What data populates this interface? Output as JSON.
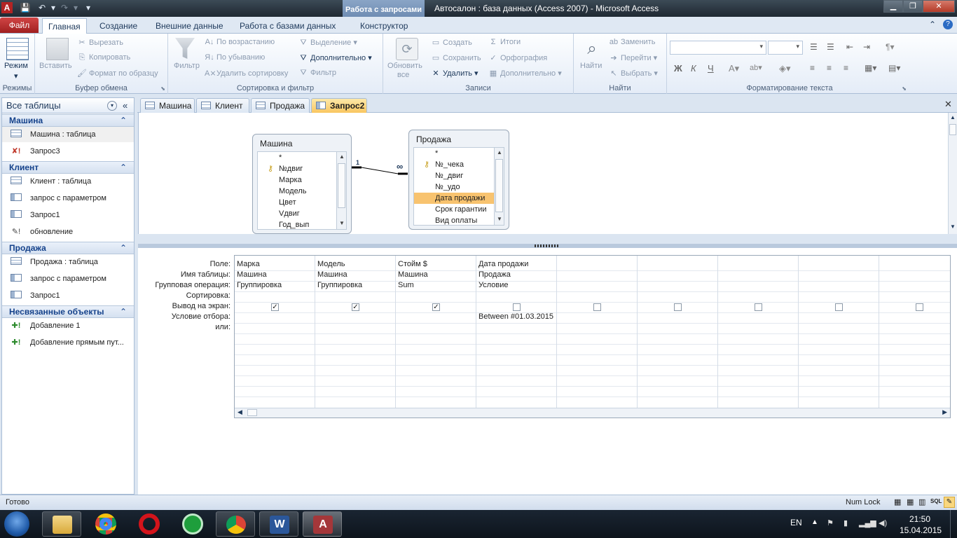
{
  "window": {
    "title": "Автосалон : база данных (Access 2007)  -  Microsoft Access",
    "context_tab": "Работа с запросами"
  },
  "ribbon_tabs": {
    "file": "Файл",
    "home": "Главная",
    "create": "Создание",
    "external": "Внешние данные",
    "database": "Работа с базами данных",
    "design": "Конструктор"
  },
  "ribbon": {
    "mode": {
      "label": "Режим",
      "group": "Режимы"
    },
    "clipboard": {
      "paste": "Вставить",
      "cut": "Вырезать",
      "copy": "Копировать",
      "format_painter": "Формат по образцу",
      "group": "Буфер обмена"
    },
    "sort": {
      "filter": "Фильтр",
      "asc": "По возрастанию",
      "desc": "По убыванию",
      "remove": "Удалить сортировку",
      "selection": "Выделение",
      "advanced": "Дополнительно",
      "toggle": "Фильтр",
      "group": "Сортировка и фильтр"
    },
    "records": {
      "refresh": "Обновить",
      "refresh2": "все",
      "new": "Создать",
      "save": "Сохранить",
      "delete": "Удалить",
      "totals": "Итоги",
      "spelling": "Орфография",
      "more": "Дополнительно",
      "group": "Записи"
    },
    "find": {
      "find": "Найти",
      "replace": "Заменить",
      "goto": "Перейти",
      "select": "Выбрать",
      "group": "Найти"
    },
    "text": {
      "bold": "Ж",
      "italic": "К",
      "underline": "Ч",
      "group": "Форматирование текста"
    }
  },
  "nav": {
    "header": "Все таблицы",
    "groups": [
      {
        "name": "Машина",
        "items": [
          "Машина : таблица",
          "Запрос3"
        ]
      },
      {
        "name": "Клиент",
        "items": [
          "Клиент : таблица",
          "запрос с параметром",
          "Запрос1",
          "обновление"
        ]
      },
      {
        "name": "Продажа",
        "items": [
          "Продажа : таблица",
          "запрос с параметром",
          "Запрос1"
        ]
      },
      {
        "name": "Несвязанные объекты",
        "items": [
          "Добавление 1",
          "Добавление прямым пут..."
        ]
      }
    ]
  },
  "doc_tabs": [
    "Машина",
    "Клиент",
    "Продажа",
    "Запрос2"
  ],
  "tables": {
    "mashina": {
      "title": "Машина",
      "fields": [
        "*",
        "№двиг",
        "Марка",
        "Модель",
        "Цвет",
        "Vдвиг",
        "Год_вып"
      ]
    },
    "prodazha": {
      "title": "Продажа",
      "fields": [
        "*",
        "№_чека",
        "№_двиг",
        "№_удо",
        "Дата продажи",
        "Срок гарантии",
        "Вид оплаты"
      ]
    },
    "relation": {
      "one": "1",
      "many": "∞"
    }
  },
  "grid": {
    "row_labels": [
      "Поле:",
      "Имя таблицы:",
      "Групповая операция:",
      "Сортировка:",
      "Вывод на экран:",
      "Условие отбора:",
      "или:"
    ],
    "columns": [
      {
        "field": "Марка",
        "table": "Машина",
        "total": "Группировка",
        "sort": "",
        "show": true,
        "criteria": ""
      },
      {
        "field": "Модель",
        "table": "Машина",
        "total": "Группировка",
        "sort": "",
        "show": true,
        "criteria": ""
      },
      {
        "field": "Стойм $",
        "table": "Машина",
        "total": "Sum",
        "sort": "",
        "show": true,
        "criteria": ""
      },
      {
        "field": "Дата продажи",
        "table": "Продажа",
        "total": "Условие",
        "sort": "",
        "show": false,
        "criteria": "Between #01.03.2015"
      },
      {
        "field": "",
        "table": "",
        "total": "",
        "sort": "",
        "show": false,
        "criteria": ""
      },
      {
        "field": "",
        "table": "",
        "total": "",
        "sort": "",
        "show": false,
        "criteria": ""
      },
      {
        "field": "",
        "table": "",
        "total": "",
        "sort": "",
        "show": false,
        "criteria": ""
      },
      {
        "field": "",
        "table": "",
        "total": "",
        "sort": "",
        "show": false,
        "criteria": ""
      },
      {
        "field": "",
        "table": "",
        "total": "",
        "sort": "",
        "show": false,
        "criteria": ""
      }
    ]
  },
  "status": {
    "ready": "Готово",
    "numlock": "Num Lock"
  },
  "taskbar": {
    "lang": "EN",
    "time": "21:50",
    "date": "15.04.2015"
  },
  "colors": {
    "accent": "#f8c36f",
    "file_tab": "#b52b2b"
  }
}
